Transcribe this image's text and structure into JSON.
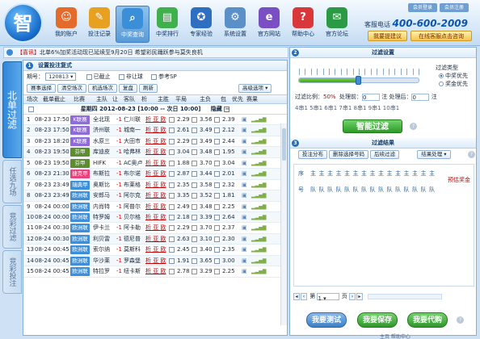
{
  "header": {
    "logo": "智",
    "nav": [
      {
        "label": "我的账户",
        "icon": "user-account-icon",
        "color": "#e46b2c"
      },
      {
        "label": "投注记录",
        "icon": "bet-record-icon",
        "color": "#e7a020"
      },
      {
        "label": "中奖查询",
        "icon": "prize-query-icon",
        "color": "#3b8fd9",
        "active": true
      },
      {
        "label": "中奖排行",
        "icon": "ranking-icon",
        "color": "#3fb04b"
      },
      {
        "label": "专家经验",
        "icon": "expert-icon",
        "color": "#2f6fc1"
      },
      {
        "label": "系统设置",
        "icon": "settings-icon",
        "color": "#5a8fc7"
      },
      {
        "label": "官方网站",
        "icon": "website-icon",
        "color": "#7a4fc4"
      },
      {
        "label": "帮助中心",
        "icon": "help-center-icon",
        "color": "#d9373a"
      },
      {
        "label": "官方论坛",
        "icon": "forum-icon",
        "color": "#2c9a45"
      }
    ],
    "member_login": "会员登录",
    "member_register": "会员注册",
    "hotline_label": "客服电话",
    "hotline_number": "400-600-2009",
    "suggest_btn": "我要提建议",
    "online_service_btn": "在线客服点击咨询"
  },
  "notice": {
    "tag": "【喜讯】",
    "text": "北单6%加奖活动现已延续至9月20日 希望彩民踊跃参与莫失良机"
  },
  "vtabs": [
    "北单过滤",
    "任选九场",
    "竞彩过滤",
    "竞彩投注"
  ],
  "left": {
    "num": "1",
    "title": "设置投注复式",
    "issue_label": "期号：",
    "issue_value": "120813",
    "opt_ended": "已截止",
    "opt_nonstop": "非让球",
    "opt_sp": "参考SP",
    "buttons": [
      "赛事选择",
      "清空场次",
      "机选场次",
      "复盘",
      "刷新"
    ],
    "filter_options": "高级选项",
    "columns": [
      "场次",
      "截单截止",
      "比赛",
      "主队",
      "让",
      "客队",
      "析",
      "主胜",
      "平局",
      "主负",
      "包",
      "优先",
      "赛果"
    ],
    "date_band": "星期四 2012-08-23 [10:00 -- 次日 10:00]",
    "hide_label": "隐藏",
    "analyze_label": "析  亚  欧",
    "rows": [
      {
        "n": "1",
        "time": "08-23 17:50",
        "league": "K联赛",
        "lc": "#8e6bd6",
        "home": "全北现",
        "hc": "-1",
        "away": "仁川联",
        "o1": "2.29",
        "o2": "3.56",
        "o3": "2.39"
      },
      {
        "n": "2",
        "time": "08-23 17:50",
        "league": "K联赛",
        "lc": "#8e6bd6",
        "home": "济州联",
        "hc": "-1",
        "away": "城南一",
        "o1": "2.61",
        "o2": "3.49",
        "o3": "2.12"
      },
      {
        "n": "3",
        "time": "08-23 18:20",
        "league": "K联赛",
        "lc": "#8e6bd6",
        "home": "水原三",
        "hc": "-1",
        "away": "大田市",
        "o1": "2.29",
        "o2": "3.49",
        "o3": "2.44"
      },
      {
        "n": "4",
        "time": "08-23 19:50",
        "league": "芬甲",
        "lc": "#5c8e2e",
        "home": "库迪皮",
        "hc": "-1",
        "away": "哈弗林",
        "o1": "3.04",
        "o2": "3.48",
        "o3": "1.95"
      },
      {
        "n": "5",
        "time": "08-23 19:50",
        "league": "芬甲",
        "lc": "#5c8e2e",
        "home": "HIFK",
        "hc": "-1",
        "away": "AC奥卢",
        "o1": "1.88",
        "o2": "3.70",
        "o3": "3.04"
      },
      {
        "n": "6",
        "time": "08-23 21:30",
        "league": "捷克甲",
        "lc": "#e6447a",
        "home": "布斯拉",
        "hc": "-1",
        "away": "布尔诺",
        "o1": "2.87",
        "o2": "3.44",
        "o3": "2.01"
      },
      {
        "n": "7",
        "time": "08-23 23:49",
        "league": "瑞典甲",
        "lc": "#3e8ed8",
        "home": "奥斯比",
        "hc": "-1",
        "away": "布莱格",
        "o1": "2.35",
        "o2": "3.58",
        "o3": "2.32"
      },
      {
        "n": "8",
        "time": "08-23 23:49",
        "league": "欧洲联",
        "lc": "#3e8ed8",
        "home": "安郎马",
        "hc": "-1",
        "away": "阿尔克",
        "o1": "3.35",
        "o2": "3.52",
        "o3": "1.81"
      },
      {
        "n": "9",
        "time": "08-24 00:00",
        "league": "欧洲联",
        "lc": "#3e8ed8",
        "home": "内肖特",
        "hc": "-1",
        "away": "阿普尔",
        "o1": "2.49",
        "o2": "3.48",
        "o3": "2.25"
      },
      {
        "n": "10",
        "time": "08-24 00:00",
        "league": "欧洲联",
        "lc": "#3e8ed8",
        "home": "特罗姆",
        "hc": "-1",
        "away": "贝尔格",
        "o1": "2.18",
        "o2": "3.39",
        "o3": "2.64"
      },
      {
        "n": "11",
        "time": "08-24 00:30",
        "league": "欧洲联",
        "lc": "#3e8ed8",
        "home": "伊卡兰",
        "hc": "-1",
        "away": "阿卡勒",
        "o1": "2.29",
        "o2": "3.70",
        "o3": "2.37"
      },
      {
        "n": "12",
        "time": "08-24 00:30",
        "league": "欧洲联",
        "lc": "#3e8ed8",
        "home": "利贝雷",
        "hc": "-1",
        "away": "德尼普",
        "o1": "2.63",
        "o2": "3.10",
        "o3": "2.30"
      },
      {
        "n": "13",
        "time": "08-24 00:45",
        "league": "欧洲联",
        "lc": "#3e8ed8",
        "home": "索尔纳",
        "hc": "-1",
        "away": "莫斯科",
        "o1": "2.45",
        "o2": "3.40",
        "o3": "2.35"
      },
      {
        "n": "14",
        "time": "08-24 00:45",
        "league": "欧洲联",
        "lc": "#3e8ed8",
        "home": "华沙莱",
        "hc": "-1",
        "away": "罗森堡",
        "o1": "1.91",
        "o2": "3.65",
        "o3": "3.00"
      },
      {
        "n": "15",
        "time": "08-24 00:45",
        "league": "欧洲联",
        "lc": "#3e8ed8",
        "home": "特拉罗",
        "hc": "-1",
        "away": "纽卡斯",
        "o1": "2.78",
        "o2": "3.29",
        "o3": "2.25"
      }
    ]
  },
  "right": {
    "s2_num": "2",
    "s2_title": "过滤设置",
    "filter_type_label": "过滤类型",
    "ft_opt1": "中奖优先",
    "ft_opt2": "奖金优先",
    "filter_ratio_label": "过滤比例：",
    "filter_ratio_value": "50%",
    "before_label": "处理前：",
    "before_value": "0",
    "after_label": "注  处理后：",
    "after_value": "0",
    "unit": "注",
    "slider_fraction": 0.5,
    "choices": "4串1    5串1    6串1    7串1    8串1    9串1    10串1",
    "smart_btn": "智能过滤",
    "s3_num": "3",
    "s3_title": "过滤结果",
    "res_btns": [
      "投注分布",
      "删除选择号码",
      "后续过滤"
    ],
    "result_process": "结果处理",
    "seq_label": "序",
    "num_label": "号",
    "host_char": "主",
    "team_char": "队",
    "prize_label": "预估奖金",
    "page_label": "第",
    "page_value": "1",
    "page_unit": "页",
    "btn_test": "我要测试",
    "btn_save": "我要保存",
    "btn_proxy": "我要代购"
  },
  "footer": "主页      帮助中心"
}
